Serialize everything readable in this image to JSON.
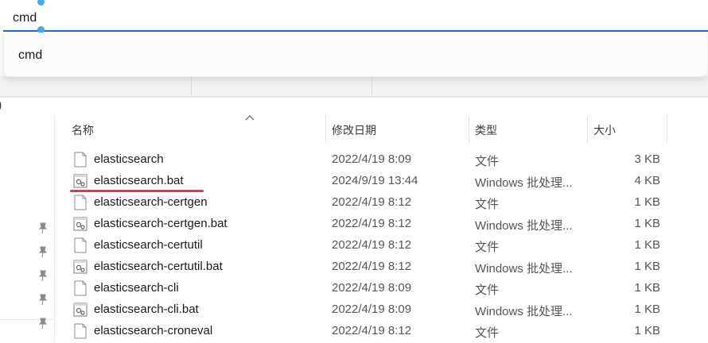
{
  "search": {
    "value": "cmd",
    "suggestions": [
      "cmd"
    ]
  },
  "bg": {
    "paren": ")"
  },
  "columns": {
    "name": "名称",
    "date": "修改日期",
    "type": "类型",
    "size": "大小"
  },
  "files": [
    {
      "name": "elasticsearch",
      "date": "2022/4/19 8:09",
      "type": "文件",
      "size": "3 KB",
      "icon": "file-icon"
    },
    {
      "name": "elasticsearch.bat",
      "date": "2024/9/19 13:44",
      "type": "Windows 批处理...",
      "size": "4 KB",
      "icon": "batch-file-icon"
    },
    {
      "name": "elasticsearch-certgen",
      "date": "2022/4/19 8:12",
      "type": "文件",
      "size": "1 KB",
      "icon": "file-icon"
    },
    {
      "name": "elasticsearch-certgen.bat",
      "date": "2022/4/19 8:12",
      "type": "Windows 批处理...",
      "size": "1 KB",
      "icon": "batch-file-icon"
    },
    {
      "name": "elasticsearch-certutil",
      "date": "2022/4/19 8:12",
      "type": "文件",
      "size": "1 KB",
      "icon": "file-icon"
    },
    {
      "name": "elasticsearch-certutil.bat",
      "date": "2022/4/19 8:12",
      "type": "Windows 批处理...",
      "size": "1 KB",
      "icon": "batch-file-icon"
    },
    {
      "name": "elasticsearch-cli",
      "date": "2022/4/19 8:09",
      "type": "文件",
      "size": "1 KB",
      "icon": "file-icon"
    },
    {
      "name": "elasticsearch-cli.bat",
      "date": "2022/4/19 8:09",
      "type": "Windows 批处理...",
      "size": "1 KB",
      "icon": "batch-file-icon"
    },
    {
      "name": "elasticsearch-croneval",
      "date": "2022/4/19 8:12",
      "type": "文件",
      "size": "1 KB",
      "icon": "file-icon"
    }
  ],
  "highlight": {
    "row": 1,
    "color": "#e8344a"
  },
  "colors": {
    "accent": "#1f6fc2",
    "caret": "#4aa9e9"
  }
}
